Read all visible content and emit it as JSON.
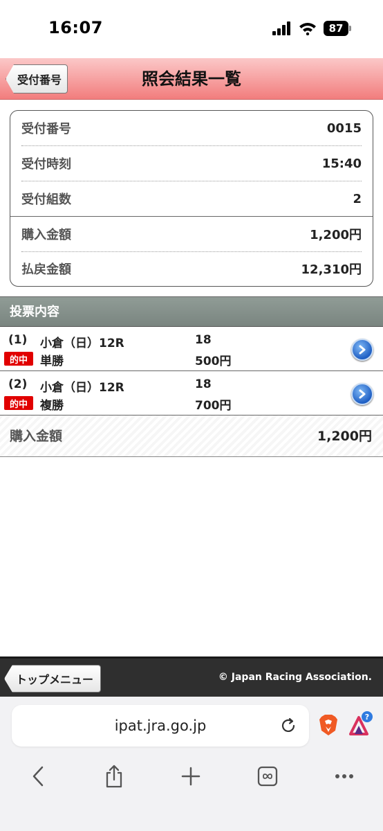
{
  "status_bar": {
    "time": "16:07",
    "battery": "87"
  },
  "header": {
    "back_label": "受付番号",
    "title": "照会結果一覧"
  },
  "receipt": {
    "rows": [
      {
        "label": "受付番号",
        "value": "0015"
      },
      {
        "label": "受付時刻",
        "value": "15:40"
      },
      {
        "label": "受付組数",
        "value": "2"
      },
      {
        "label": "購入金額",
        "value": "1,200円"
      },
      {
        "label": "払戻金額",
        "value": "12,310円"
      }
    ]
  },
  "section": {
    "title": "投票内容"
  },
  "bets": [
    {
      "num": "(1)",
      "race": "小倉（日）12R",
      "horse": "18",
      "badge": "的中",
      "type": "単勝",
      "amount": "500円"
    },
    {
      "num": "(2)",
      "race": "小倉（日）12R",
      "horse": "18",
      "badge": "的中",
      "type": "複勝",
      "amount": "700円"
    }
  ],
  "total": {
    "label": "購入金額",
    "value": "1,200円"
  },
  "footer": {
    "top_menu_label": "トップメニュー",
    "copyright": "© Japan Racing Association."
  },
  "browser": {
    "url": "ipat.jra.go.jp"
  },
  "colors": {
    "header_pink": "#f27d7d",
    "hit_red": "#e10000",
    "section_gray": "#7a8580",
    "footer_dark": "#2f2f2f"
  }
}
